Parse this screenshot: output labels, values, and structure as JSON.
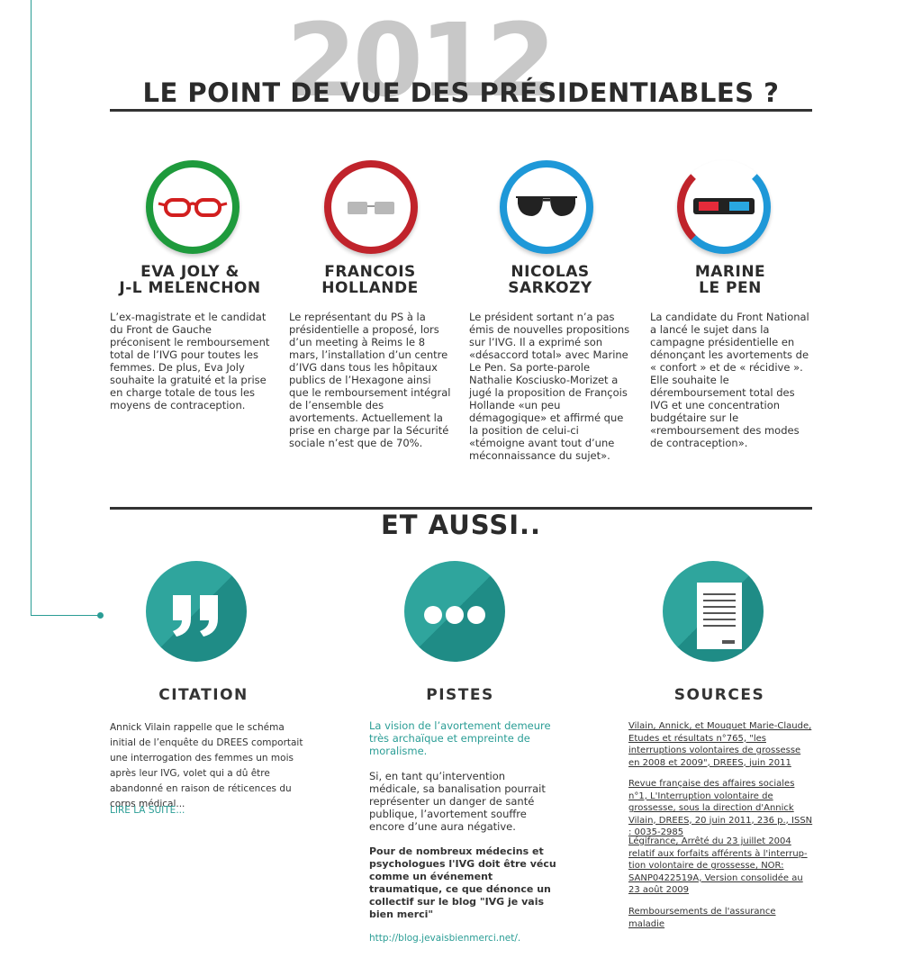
{
  "header": {
    "year": "2012",
    "title": "LE POINT DE VUE DES PRÉSIDENTIABLES ?"
  },
  "colors": {
    "teal": "#2a9d95",
    "green": "#1e9a3c",
    "red": "#c0232b",
    "blue": "#1e98d8",
    "dark": "#2b2b2b"
  },
  "candidates": [
    {
      "icon": "red-glasses-icon",
      "name_line1": "EVA JOLY &",
      "name_line2": "J-L MELENCHON",
      "text": "L’ex-magistrate et le candidat du Front de Gauche préconisent le remboursement total de l’IVG pour toutes les femmes. De plus, Eva Joly souhaite la gratuité et la prise en charge totale de tous les moyens de contraception."
    },
    {
      "icon": "rectangular-glasses-icon",
      "name_line1": "FRANCOIS",
      "name_line2": "HOLLANDE",
      "text": "Le représentant du PS à la présidentielle a proposé, lors d’un meeting à Reims le 8 mars, l’installation d’un centre d’IVG dans tous les hôpitaux publics de l’Hexagone ainsi que le remboursement intégral de l’ensemble des avortements. Actuellement la prise en charge par la Sécurité sociale n’est que de 70%."
    },
    {
      "icon": "aviator-sunglasses-icon",
      "name_line1": "NICOLAS",
      "name_line2": "SARKOZY",
      "text": "Le président sortant n’a pas émis de nouvelles propositions sur l’IVG. Il a exprimé son «désaccord total» avec Marine Le Pen. Sa porte-parole Nathalie Kosciusko-Morizet a jugé la proposition de François Hollande «un peu démagogique» et affirmé que la position de celui-ci «témoigne avant tout d’une méconnaissance du sujet»."
    },
    {
      "icon": "3d-glasses-icon",
      "name_line1": "MARINE",
      "name_line2": "LE PEN",
      "text": "La candidate du Front National a lancé le sujet dans la campagne présidentielle en dénonçant les avortements de « confort » et de « récidive ». Elle souhaite le déremboursement total des IVG et une concentration budgétaire sur le «remboursement des modes de contraception»."
    }
  ],
  "aussi": {
    "title": "ET AUSSI.."
  },
  "citation": {
    "title": "CITATION",
    "text": "Annick Vilain rappelle que le schéma initial de l’enquête du DREES comportait une interrogation des femmes un mois après leur IVG, volet qui a dû être abandonné en raison de réticences du corps médical...",
    "link": "LIRE LA SUITE..."
  },
  "pistes": {
    "title": "PISTES",
    "intro": "La vision de l’avortement demeure très archaïque et empreinte de moralisme.",
    "para": "Si, en tant qu’intervention médicale, sa banalisation pourrait représenter un danger de santé publique, l’avortement souffre encore d’une aura négative.",
    "bold": "Pour de nombreux médecins et psychologues l'IVG doit être vécu comme un événement traumatique, ce que dénonce un collectif sur le blog \"IVG je vais bien merci\"",
    "url": "http://blog.jevaisbienmerci.net/."
  },
  "sources": {
    "title": "SOURCES",
    "items": [
      "Vilain, Annick, et Mouquet Marie-Claude, Etudes et résultats n°765, \"les interruptions volontaires de grossesse en 2008 et 2009\", DREES, juin 2011",
      "Revue française des affaires sociales n°1, L'Interruption volontaire de grossesse, sous la direction d'Annick Vilain, DREES, 20 juin 2011, 236 p., ISSN : 0035-2985",
      "Légifrance, Arrêté du 23 juillet 2004 relatif aux forfaits afférents à l'interrup-tion volontaire de grossesse, NOR: SANP0422519A, Version consolidée au 23 août 2009",
      "Remboursements de l'assurance maladie"
    ]
  }
}
